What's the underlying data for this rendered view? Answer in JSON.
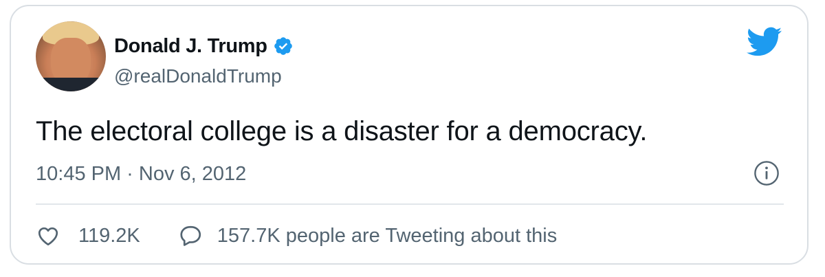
{
  "tweet": {
    "display_name": "Donald J. Trump",
    "handle": "@realDonaldTrump",
    "verified": true,
    "text": "The electoral college is a disaster for a democracy.",
    "timestamp": "10:45 PM · Nov 6, 2012",
    "likes": "119.2K",
    "tweeting_about": "157.7K people are Tweeting about this"
  },
  "icons": {
    "verified": "verified-badge-icon",
    "brand": "twitter-bird-icon",
    "info": "info-icon",
    "like": "heart-icon",
    "reply": "speech-bubble-icon"
  },
  "colors": {
    "brand_blue": "#1d9bf0",
    "text_primary": "#0f1419",
    "text_secondary": "#536471",
    "border": "#d9dee3"
  }
}
